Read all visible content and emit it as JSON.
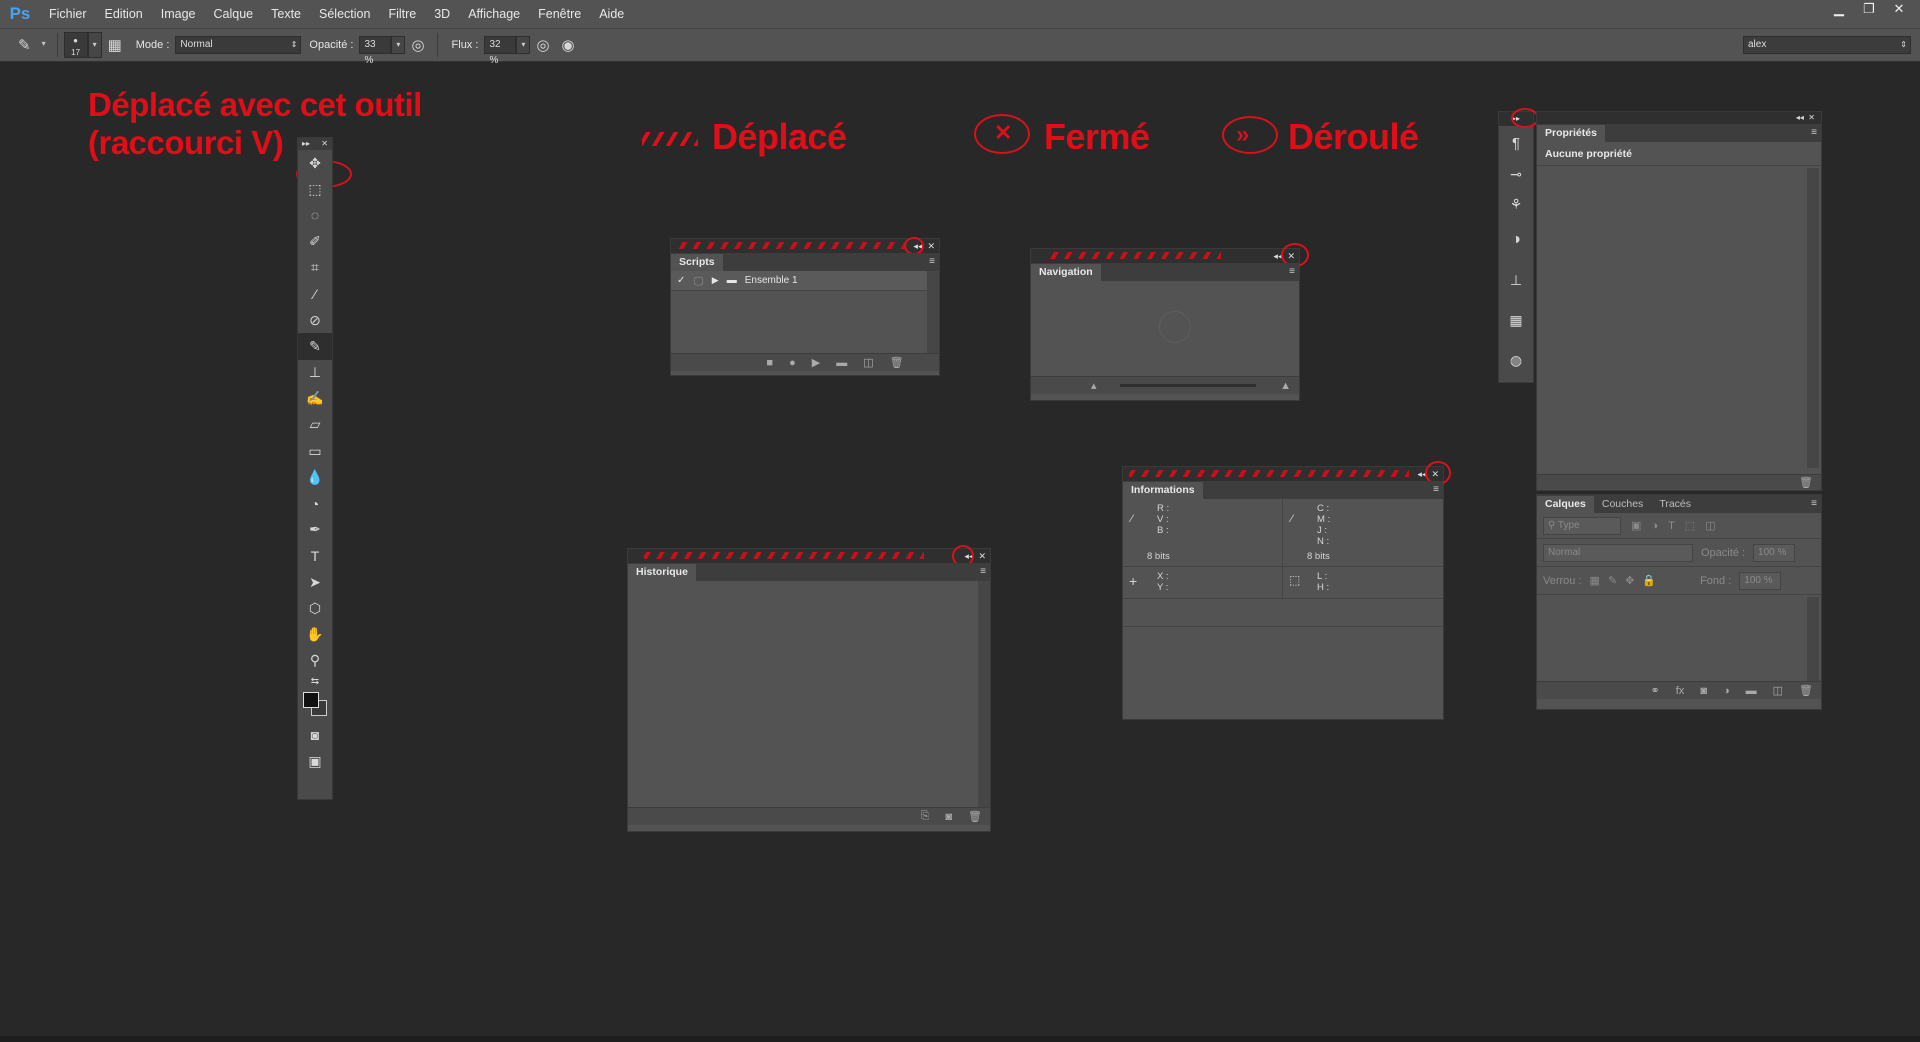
{
  "app": {
    "logo": "Ps"
  },
  "menubar": {
    "items": [
      "Fichier",
      "Edition",
      "Image",
      "Calque",
      "Texte",
      "Sélection",
      "Filtre",
      "3D",
      "Affichage",
      "Fenêtre",
      "Aide"
    ]
  },
  "optbar": {
    "brush_size": "17",
    "mode_label": "Mode :",
    "mode_value": "Normal",
    "opacity_label": "Opacité :",
    "opacity_value": "33 %",
    "flow_label": "Flux :",
    "flow_value": "32 %",
    "workspace_value": "alex"
  },
  "annotations": {
    "move_tool": "Déplacé avec cet outil",
    "move_tool_shortcut": "(raccourci V)",
    "moved": "Déplacé",
    "closed": "Fermé",
    "expanded": "Déroulé"
  },
  "panels": {
    "scripts": {
      "tab": "Scripts",
      "row_label": "Ensemble 1"
    },
    "navigation": {
      "tab": "Navigation"
    },
    "history": {
      "tab": "Historique"
    },
    "info": {
      "tab": "Informations",
      "rgb": [
        "R :",
        "V :",
        "B :"
      ],
      "cmyk": [
        "C :",
        "M :",
        "J :",
        "N :"
      ],
      "bits_left": "8 bits",
      "bits_right": "8 bits",
      "xy": [
        "X :",
        "Y :"
      ],
      "lh": [
        "L :",
        "H :"
      ]
    },
    "properties": {
      "tab": "Propriétés",
      "message": "Aucune propriété"
    },
    "layers": {
      "tabs": [
        "Calques",
        "Couches",
        "Tracés"
      ],
      "filter_placeholder": "Type",
      "blend_value": "Normal",
      "opacity_label": "Opacité :",
      "opacity_value": "100 %",
      "lock_label": "Verrou :",
      "fill_label": "Fond :",
      "fill_value": "100 %"
    }
  },
  "colors": {
    "accent": "#e10d18",
    "ui": "#535353",
    "workspace": "#282828"
  }
}
